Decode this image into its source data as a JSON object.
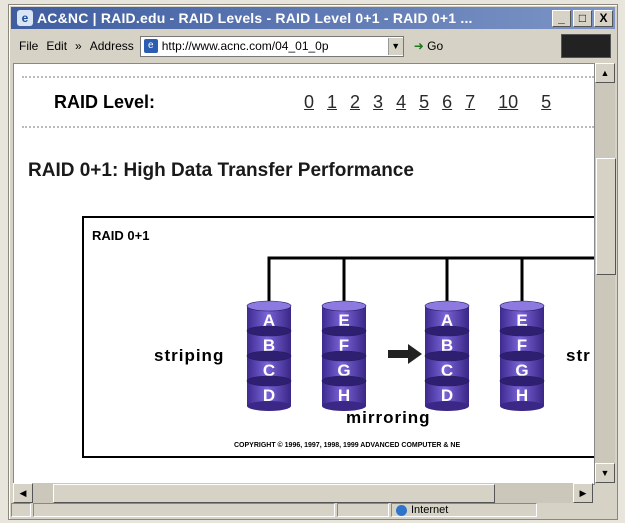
{
  "window": {
    "title": "AC&NC | RAID.edu - RAID Levels - RAID Level 0+1 - RAID 0+1 ...",
    "min": "_",
    "max": "□",
    "close": "X"
  },
  "toolbar": {
    "file": "File",
    "edit": "Edit",
    "more": "»",
    "address_label": "Address",
    "url": "http://www.acnc.com/04_01_0p",
    "go": "Go"
  },
  "page": {
    "raid_label": "RAID Level:",
    "levels": [
      "0",
      "1",
      "2",
      "3",
      "4",
      "5",
      "6",
      "7",
      "10",
      "5"
    ],
    "headline": "RAID 0+1: High Data Transfer Performance"
  },
  "diagram": {
    "label": "RAID 0+1",
    "left_text": "striping",
    "right_text": "str",
    "bottom_text": "mirroring",
    "copyright": "COPYRIGHT © 1996, 1997, 1998, 1999 ADVANCED COMPUTER & NE",
    "disk1": [
      "A",
      "B",
      "C",
      "D"
    ],
    "disk2": [
      "E",
      "F",
      "G",
      "H"
    ],
    "disk3": [
      "A",
      "B",
      "C",
      "D"
    ],
    "disk4": [
      "E",
      "F",
      "G",
      "H"
    ],
    "disk_color": "#5b44b8"
  },
  "status": {
    "zone": "Internet"
  }
}
